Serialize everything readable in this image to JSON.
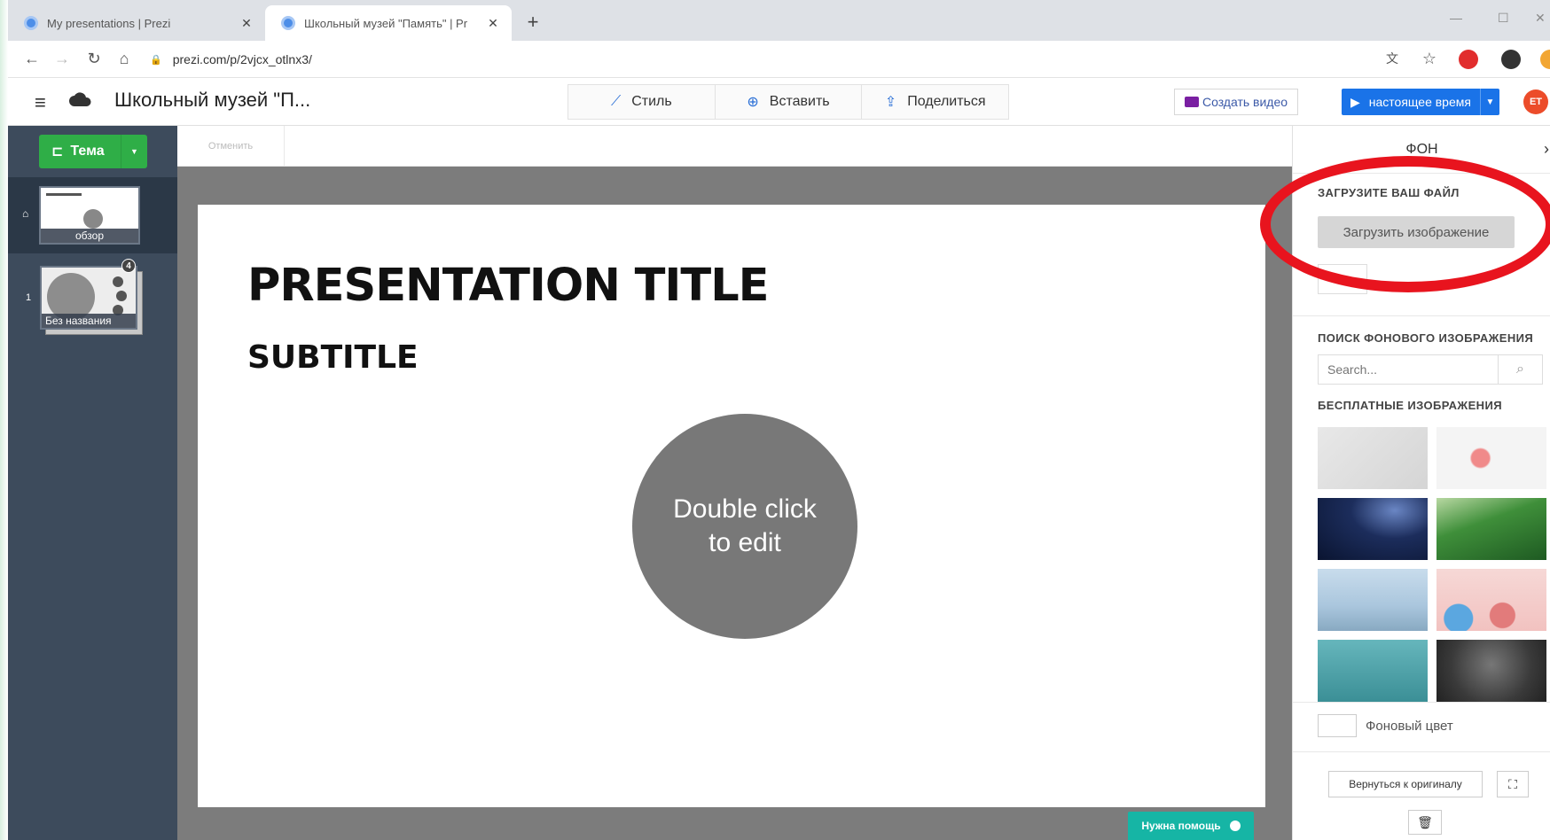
{
  "browser": {
    "tabs": [
      {
        "title": "My presentations | Prezi",
        "active": false
      },
      {
        "title": "Школьный музей \"Память\" | Pr",
        "active": true
      }
    ],
    "new_tab": "+",
    "url": "prezi.com/p/2vjcx_otlnx3/"
  },
  "topbar": {
    "doc_title": "Школьный музей \"П...",
    "tools": [
      {
        "label": "Стиль",
        "icon": "wand-icon"
      },
      {
        "label": "Вставить",
        "icon": "plus-circle-icon"
      },
      {
        "label": "Поделиться",
        "icon": "share-icon"
      }
    ],
    "create_video": "Создать видео",
    "present_label": "настоящее время",
    "avatar_initials": "ET"
  },
  "sidebar": {
    "theme_label": "Тема",
    "overview_caption": "обзор",
    "step_number": "1",
    "slide_caption": "Без названия",
    "badge_count": "4"
  },
  "canvas": {
    "undo_label": "Отменить",
    "slide_title": "PRESENTATION TITLE",
    "slide_subtitle": "SUBTITLE",
    "circle_text_line1": "Double click",
    "circle_text_line2": "to edit",
    "help_label": "Нужна помощь"
  },
  "panel": {
    "title": "ФОН",
    "upload_section": "ЗАГРУЗИТЕ ВАШ ФАЙЛ",
    "upload_button": "Загрузить изображение",
    "search_section": "ПОИСК ФОНОВОГО ИЗОБРАЖЕНИЯ",
    "search_placeholder": "Search...",
    "free_images_section": "БЕСПЛАТНЫЕ ИЗОБРАЖЕНИЯ",
    "bg_color_label": "Фоновый цвет",
    "revert_label": "Вернуться к оригиналу"
  },
  "colors": {
    "accent_blue": "#1a73e8",
    "theme_green": "#2fae47",
    "sidebar_bg": "#3d4b5c",
    "help_teal": "#16b5a5",
    "annotation_red": "#e8141e"
  }
}
